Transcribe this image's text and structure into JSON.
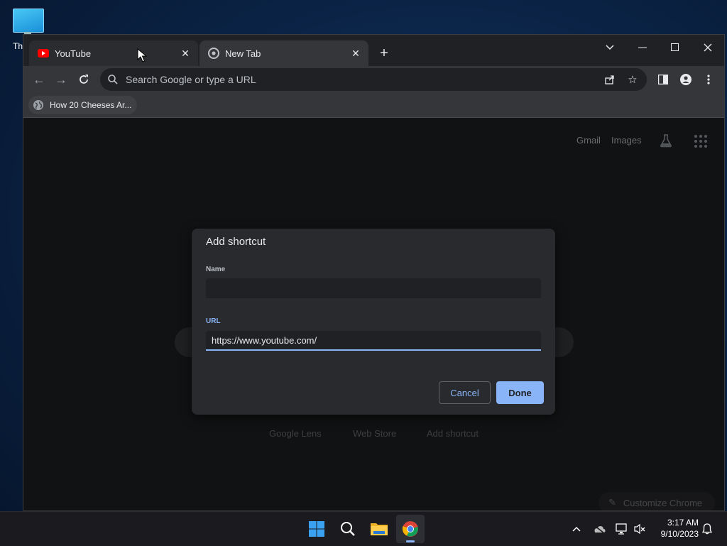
{
  "desktop": {
    "icon_label": "Th"
  },
  "browser": {
    "tabs": [
      {
        "title": "YouTube",
        "favicon": "youtube-icon"
      },
      {
        "title": "New Tab",
        "favicon": "chrome-icon"
      }
    ],
    "omnibox": {
      "placeholder": "Search Google or type a URL"
    },
    "bookmarks": [
      {
        "label": "How 20 Cheeses Ar...",
        "icon": "globe-icon"
      }
    ],
    "ntp": {
      "links": {
        "gmail": "Gmail",
        "images": "Images"
      },
      "shortcuts": {
        "google_lens": "Google Lens",
        "web_store": "Web Store",
        "add_shortcut": "Add shortcut"
      },
      "customize": "Customize Chrome"
    }
  },
  "dialog": {
    "title": "Add shortcut",
    "name_label": "Name",
    "name_value": "",
    "url_label": "URL",
    "url_value": "https://www.youtube.com/",
    "cancel_label": "Cancel",
    "done_label": "Done"
  },
  "taskbar": {
    "time": "3:17 AM",
    "date": "9/10/2023"
  },
  "colors": {
    "accent": "#8ab4f8",
    "background": "#202124",
    "dialog": "#292a2d"
  }
}
